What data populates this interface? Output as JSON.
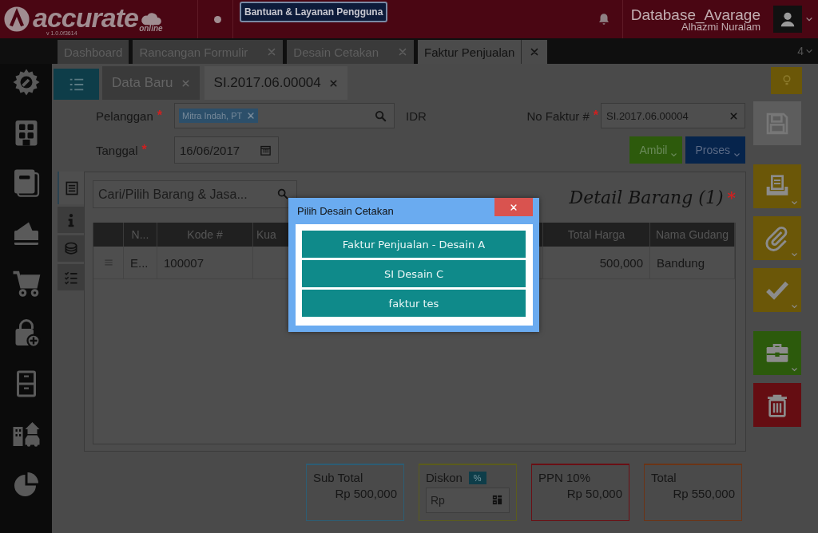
{
  "header": {
    "logo": "accurate",
    "logo_sub": "online",
    "version": "v 1.0.0f3614",
    "help_button": "Bantuan & Layanan Pengguna",
    "database": "Database_Avarage",
    "user": "Alhazmi Nuralam"
  },
  "main_tabs": [
    {
      "label": "Dashboard",
      "selected": false,
      "closable": false
    },
    {
      "label": "Rancangan Formulir",
      "selected": false,
      "closable": true
    },
    {
      "label": "Desain Cetakan",
      "selected": false,
      "closable": true
    },
    {
      "label": "Faktur Penjualan",
      "selected": true,
      "closable": true
    }
  ],
  "tab_count": "4",
  "doc_tabs": [
    {
      "label": "Data Baru",
      "selected": false
    },
    {
      "label": "SI.2017.06.00004",
      "selected": true
    }
  ],
  "form": {
    "customer_label": "Pelanggan",
    "customer_required": "*",
    "customer": "Mitra Indah, PT",
    "currency": "IDR",
    "date_label": "Tanggal",
    "date_required": "*",
    "date": "16/06/2017",
    "invoice_label": "No Faktur #",
    "invoice_required": "*",
    "invoice": "SI.2017.06.00004",
    "buttons": [
      {
        "label": "Ambil",
        "color": "#2d5a0c"
      },
      {
        "label": "Proses",
        "color": "#06244c"
      }
    ]
  },
  "side_tabs": [
    {
      "kind": "list",
      "selected": true
    },
    {
      "kind": "info",
      "selected": false
    },
    {
      "kind": "coins",
      "selected": false
    },
    {
      "kind": "checklist",
      "selected": false
    }
  ],
  "item_search": {
    "placeholder": "Cari/Pilih Barang & Jasa..."
  },
  "detail_title": "Detail Barang (1)",
  "detail_required": "*",
  "table": {
    "columns": [
      "",
      "N...",
      "Kode #",
      "Kua",
      "Total Harga",
      "Nama Gudang"
    ],
    "rows": [
      [
        "",
        "E...",
        "100007",
        "",
        "500,000",
        "Bandung"
      ]
    ]
  },
  "summary": [
    {
      "kind": "amount",
      "label": "Sub Total",
      "value": "Rp 500,000",
      "color": "#2c5d74"
    },
    {
      "kind": "discount",
      "label": "Diskon",
      "badge": "%",
      "placeholder": "Rp",
      "color": "#5b5c1c"
    },
    {
      "kind": "amount",
      "label": "PPN 10%",
      "value": "Rp 50,000",
      "color": "#6a0f14"
    },
    {
      "kind": "amount",
      "label": "Total",
      "value": "Rp 550,000",
      "color": "#6b3416"
    }
  ],
  "actions": [
    [
      {
        "kind": "save",
        "color": "#5d5d5d",
        "has_menu": false
      }
    ],
    [
      {
        "kind": "print",
        "color": "#6b5708",
        "has_menu": true
      },
      {
        "kind": "attach",
        "color": "#6b5708",
        "has_menu": true
      },
      {
        "kind": "check",
        "color": "#6b5708",
        "has_menu": true
      }
    ],
    [
      {
        "kind": "briefcase",
        "color": "#2c5a0c",
        "has_menu": true
      },
      {
        "kind": "trash",
        "color": "#650d12",
        "has_menu": false
      }
    ]
  ],
  "dialog": {
    "title": "Pilih Desain Cetakan",
    "options": [
      "Faktur Penjualan - Desain A",
      "SI Desain C",
      "faktur tes"
    ]
  }
}
